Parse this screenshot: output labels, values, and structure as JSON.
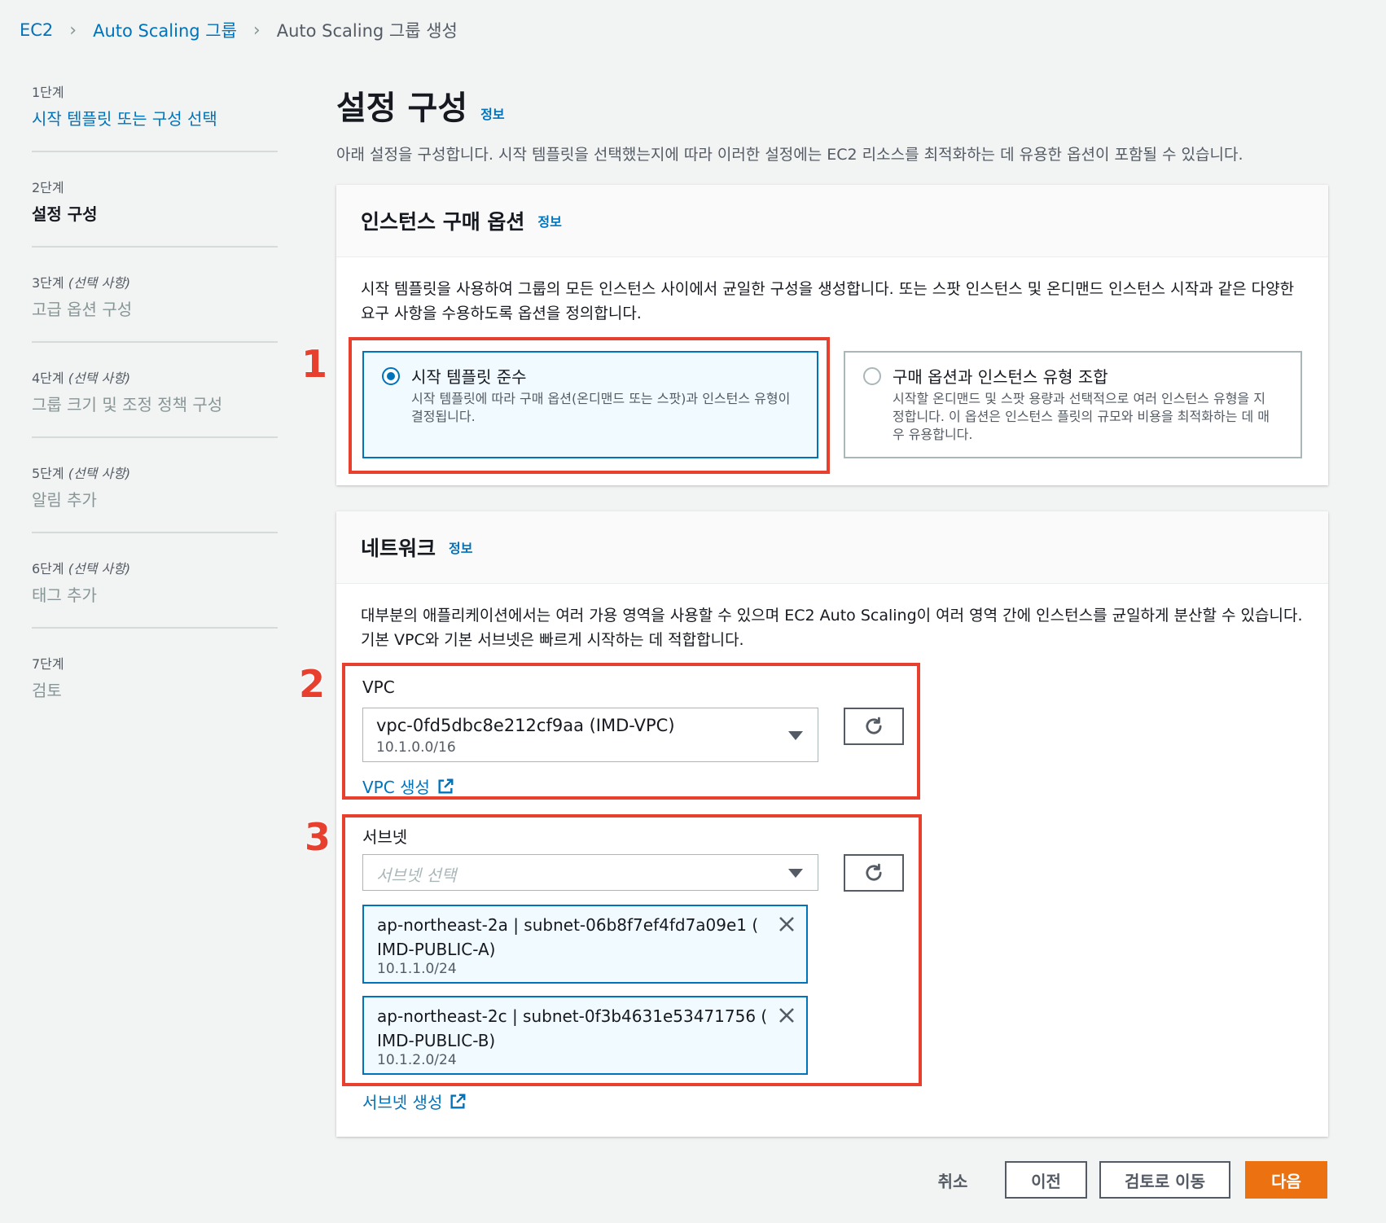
{
  "breadcrumb": {
    "items": [
      "EC2",
      "Auto Scaling 그룹"
    ],
    "current": "Auto Scaling 그룹 생성"
  },
  "steps": [
    {
      "num": "1단계",
      "optional": "",
      "title": "시작 템플릿 또는 구성 선택"
    },
    {
      "num": "2단계",
      "optional": "",
      "title": "설정 구성"
    },
    {
      "num": "3단계",
      "optional": "(선택 사항)",
      "title": "고급 옵션 구성"
    },
    {
      "num": "4단계",
      "optional": "(선택 사항)",
      "title": "그룹 크기 및 조정 정책 구성"
    },
    {
      "num": "5단계",
      "optional": "(선택 사항)",
      "title": "알림 추가"
    },
    {
      "num": "6단계",
      "optional": "(선택 사항)",
      "title": "태그 추가"
    },
    {
      "num": "7단계",
      "optional": "",
      "title": "검토"
    }
  ],
  "page": {
    "title": "설정 구성",
    "info": "정보",
    "description": "아래 설정을 구성합니다. 시작 템플릿을 선택했는지에 따라 이러한 설정에는 EC2 리소스를 최적화하는 데 유용한 옵션이 포함될 수 있습니다."
  },
  "purchase": {
    "title": "인스턴스 구매 옵션",
    "info": "정보",
    "description": "시작 템플릿을 사용하여 그룹의 모든 인스턴스 사이에서 균일한 구성을 생성합니다. 또는 스팟 인스턴스 및 온디맨드 인스턴스 시작과 같은 다양한 요구 사항을 수용하도록 옵션을 정의합니다.",
    "option1_title": "시작 템플릿 준수",
    "option1_desc": "시작 템플릿에 따라 구매 옵션(온디맨드 또는 스팟)과 인스턴스 유형이 결정됩니다.",
    "option2_title": "구매 옵션과 인스턴스 유형 조합",
    "option2_desc": "시작할 온디맨드 및 스팟 용량과 선택적으로 여러 인스턴스 유형을 지정합니다. 이 옵션은 인스턴스 플릿의 규모와 비용을 최적화하는 데 매우 유용합니다."
  },
  "network": {
    "title": "네트워크",
    "info": "정보",
    "description": "대부분의 애플리케이션에서는 여러 가용 영역을 사용할 수 있으며 EC2 Auto Scaling이 여러 영역 간에 인스턴스를 균일하게 분산할 수 있습니다. 기본 VPC와 기본 서브넷은 빠르게 시작하는 데 적합합니다.",
    "vpc_label": "VPC",
    "vpc_value": "vpc-0fd5dbc8e212cf9aa (IMD-VPC)",
    "vpc_cidr": "10.1.0.0/16",
    "vpc_create": "VPC 생성",
    "subnet_label": "서브넷",
    "subnet_placeholder": "서브넷 선택",
    "subnets": [
      {
        "line1": "ap-northeast-2a | subnet-06b8f7ef4fd7a09e1 (",
        "line2": "IMD-PUBLIC-A)",
        "cidr": "10.1.1.0/24"
      },
      {
        "line1": "ap-northeast-2c | subnet-0f3b4631e53471756 (",
        "line2": "IMD-PUBLIC-B)",
        "cidr": "10.1.2.0/24"
      }
    ],
    "subnet_create": "서브넷 생성"
  },
  "annotations": [
    "1",
    "2",
    "3"
  ],
  "footer": {
    "cancel": "취소",
    "previous": "이전",
    "review": "검토로 이동",
    "next": "다음"
  },
  "colors": {
    "link": "#0073bb",
    "primary": "#ec7211",
    "annotation": "#e8402f"
  }
}
